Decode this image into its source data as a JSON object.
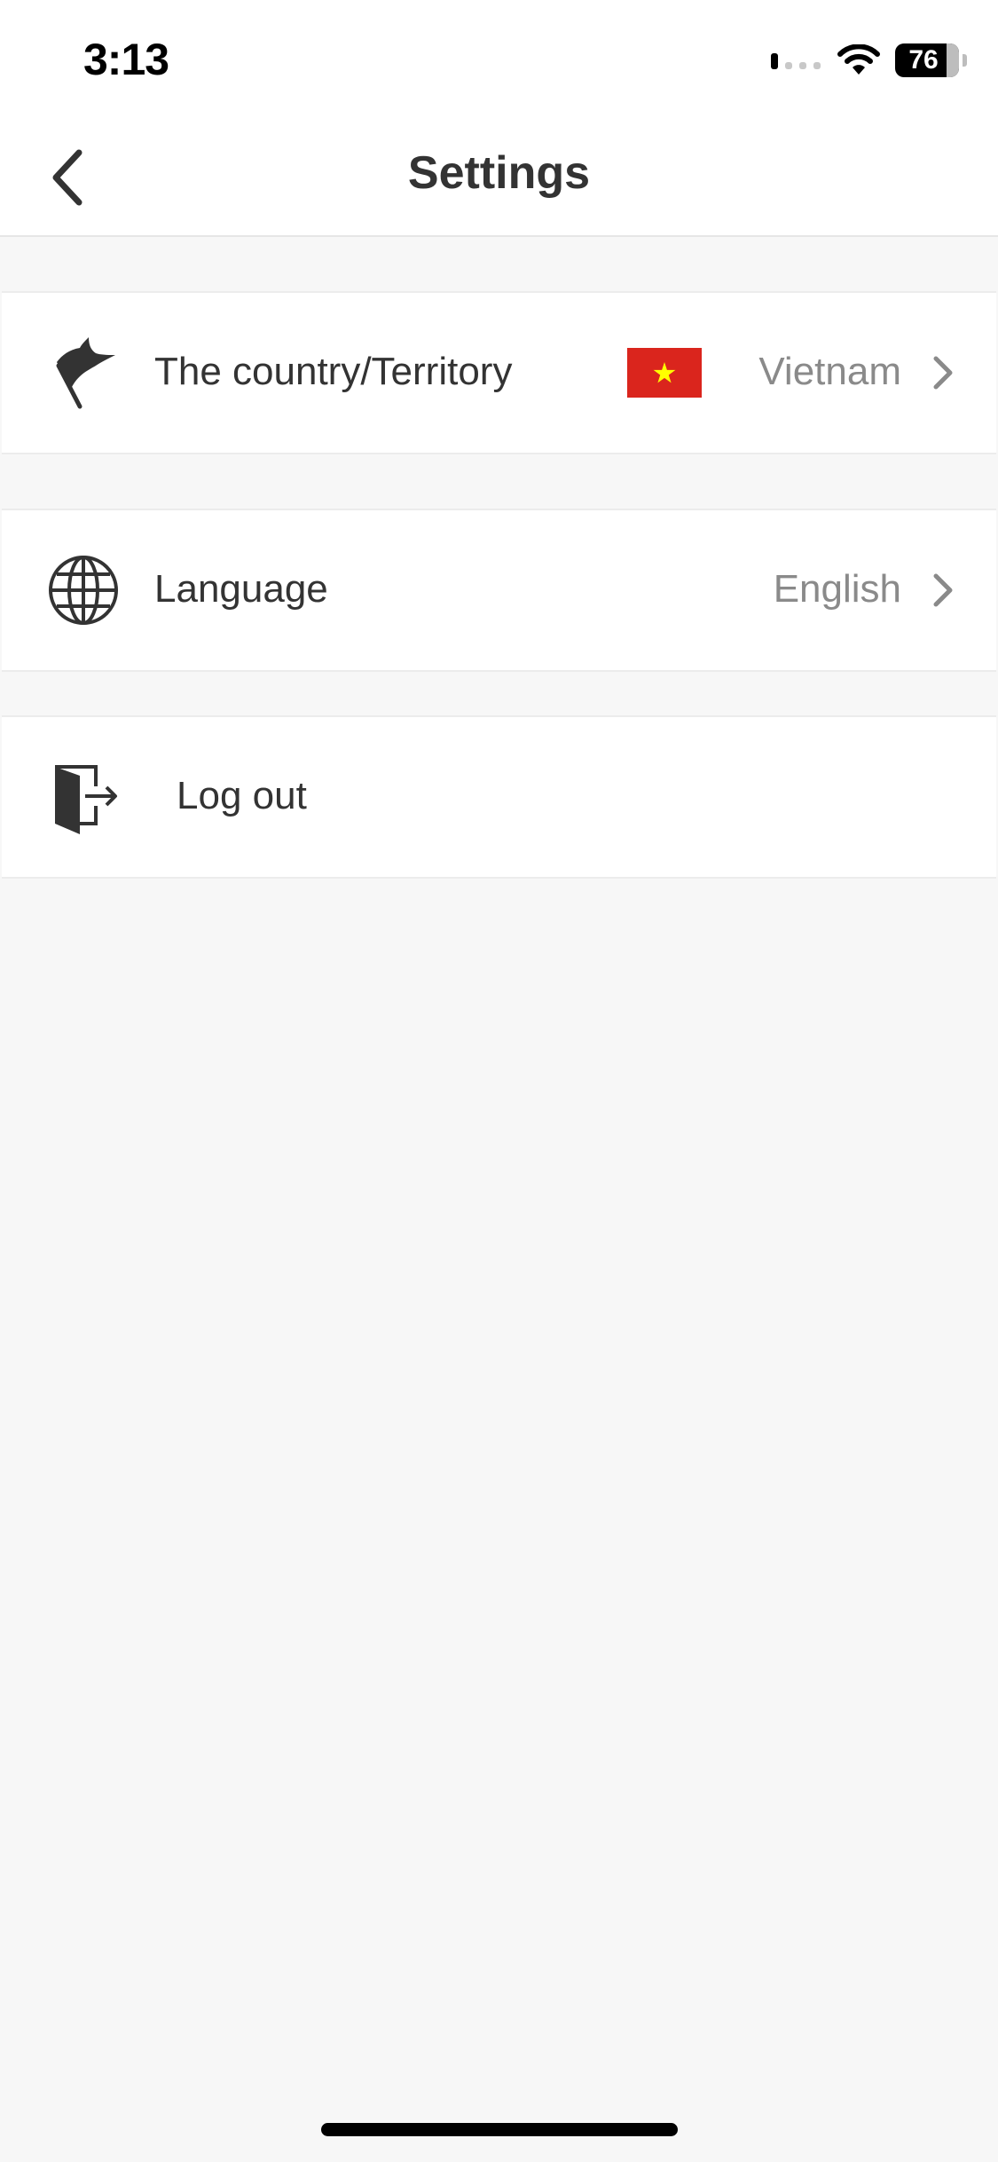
{
  "status_bar": {
    "time": "3:13",
    "battery": "76",
    "icons": [
      "signal-icon",
      "wifi-icon",
      "battery-icon"
    ]
  },
  "nav": {
    "title": "Settings",
    "back_icon": "chevron-left-icon"
  },
  "settings": {
    "country": {
      "label": "The country/Territory",
      "value": "Vietnam",
      "icon": "flag-icon",
      "flag": "vietnam-flag-icon"
    },
    "language": {
      "label": "Language",
      "value": "English",
      "icon": "globe-icon"
    },
    "logout": {
      "label": "Log out",
      "icon": "logout-door-icon"
    }
  },
  "colors": {
    "background": "#f7f7f7",
    "row_background": "#ffffff",
    "text": "#333333",
    "secondary_text": "#8a8a8a",
    "flag_red": "#da251d",
    "flag_star": "#ffff00"
  }
}
